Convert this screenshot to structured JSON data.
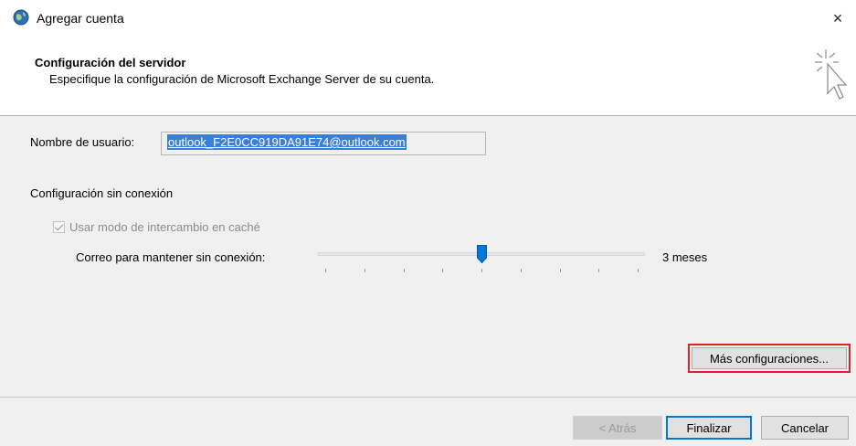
{
  "window": {
    "title": "Agregar cuenta",
    "close_glyph": "×"
  },
  "header": {
    "title": "Configuración del servidor",
    "subtitle": "Especifique la configuración de Microsoft Exchange Server de su cuenta."
  },
  "form": {
    "username_label": "Nombre de usuario:",
    "username_value": "outlook_F2E0CC919DA91E74@outlook.com",
    "offline_section_label": "Configuración sin conexión",
    "cached_mode_label": "Usar modo de intercambio en caché",
    "cached_mode_checked": true,
    "cached_mode_enabled": false,
    "mail_offline_label": "Correo para mantener sin conexión:",
    "mail_offline_value": "3 meses",
    "slider_position_fraction": 0.5,
    "slider_tick_count": 9,
    "more_settings_label": "Más configuraciones..."
  },
  "footer": {
    "back_label": "< Atrás",
    "finish_label": "Finalizar",
    "cancel_label": "Cancelar"
  },
  "colors": {
    "accent": "#0078d7",
    "highlight": "#e2202a",
    "selection": "#3a7fd5"
  },
  "icons": {
    "app": "outlook-globe-icon",
    "wizard": "click-cursor-icon",
    "close": "close-icon"
  }
}
